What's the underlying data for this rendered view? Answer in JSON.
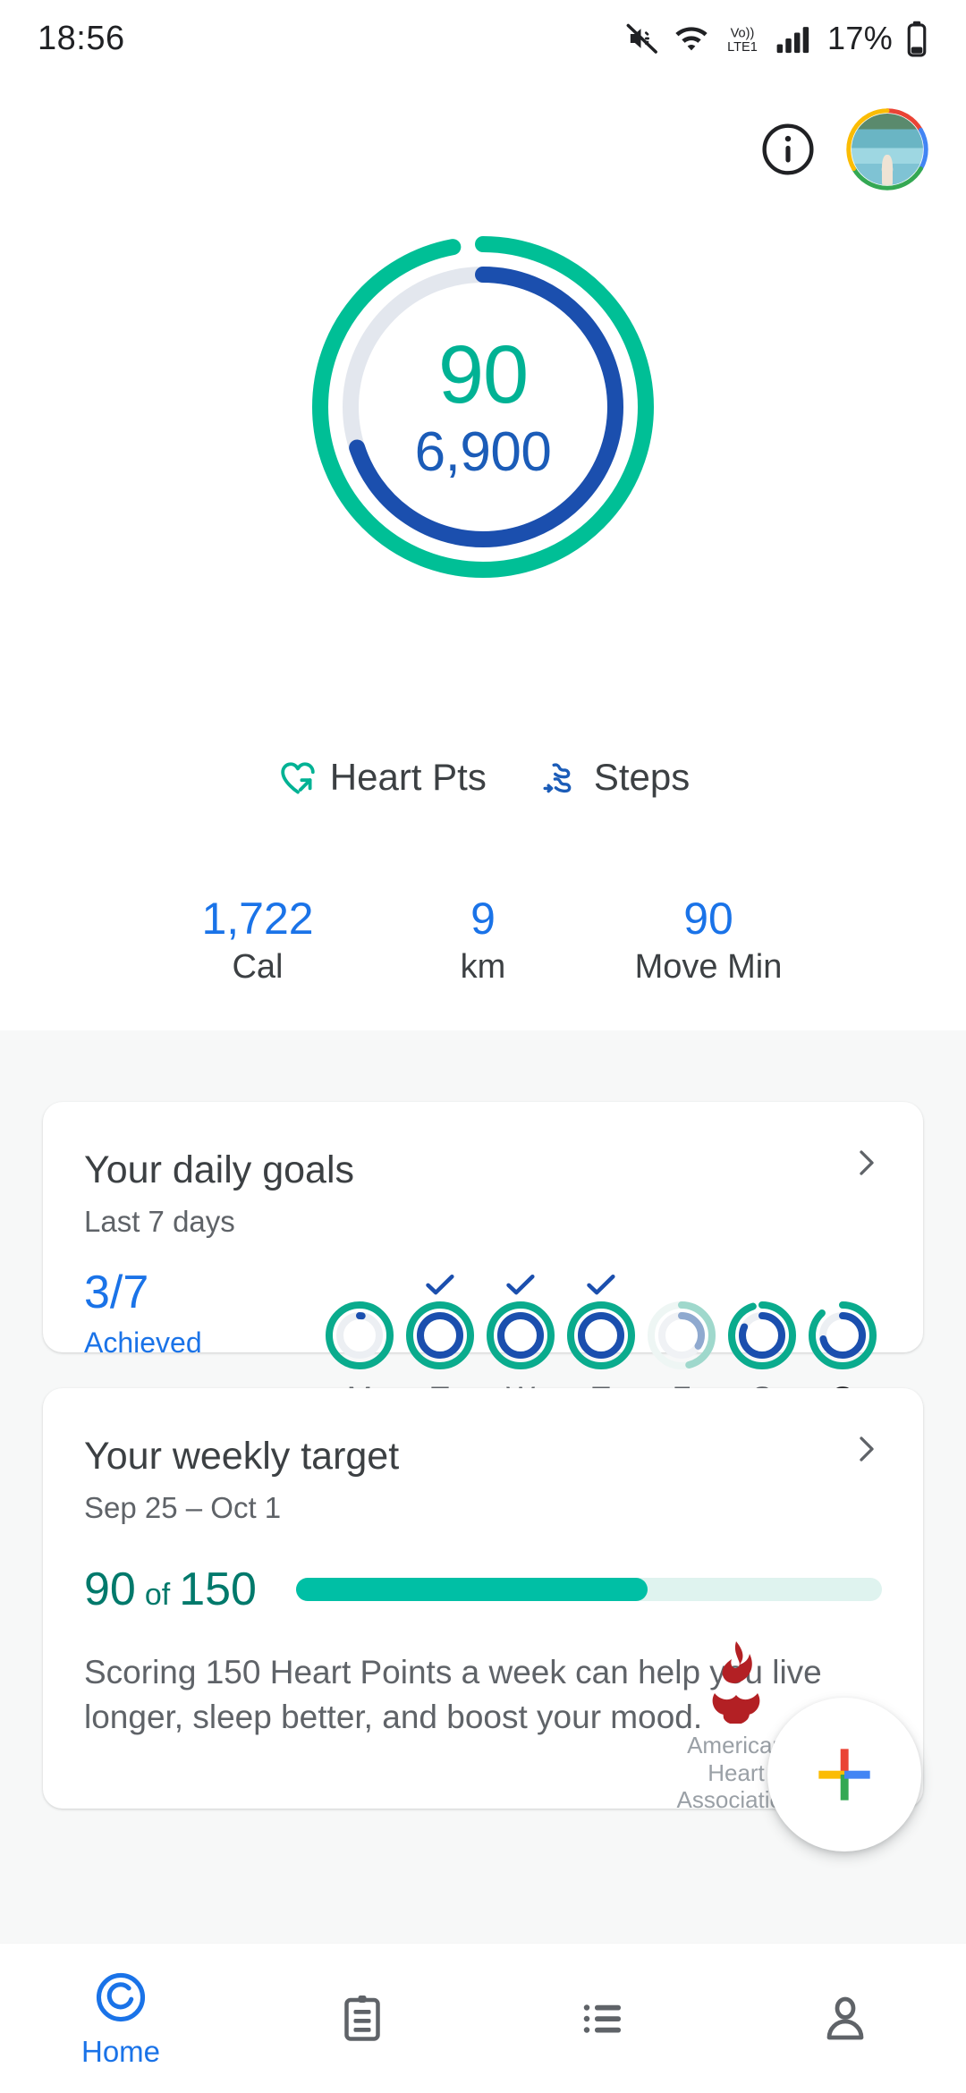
{
  "status_bar": {
    "time": "18:56",
    "battery_percent": "17%",
    "network_label": "LTE1",
    "volte_label": "Vo))",
    "icons": [
      "mute-icon",
      "wifi-icon",
      "volte-icon",
      "signal-icon",
      "battery-icon"
    ]
  },
  "top_actions": {
    "info_label": "i",
    "avatar_label": "profile-avatar"
  },
  "main_ring": {
    "heart_points": "90",
    "steps": "6,900",
    "heart_points_color": "#00b294",
    "steps_color": "#1b5cb8",
    "track_color": "#e3e7ee",
    "heart_points_pct": 97,
    "steps_pct": 70
  },
  "legend": [
    {
      "label": "Heart Pts",
      "icon": "heart-arrow-icon",
      "color": "#00b294"
    },
    {
      "label": "Steps",
      "icon": "shoe-icon",
      "color": "#1b5cb8"
    }
  ],
  "stats": [
    {
      "value": "1,722",
      "unit": "Cal"
    },
    {
      "value": "9",
      "unit": "km"
    },
    {
      "value": "90",
      "unit": "Move Min"
    }
  ],
  "daily_goals_card": {
    "title": "Your daily goals",
    "subtitle": "Last 7 days",
    "achieved_fraction": "3/7",
    "achieved_label": "Achieved",
    "chevron": "chevron-right-icon",
    "days": [
      {
        "label": "M",
        "heart_pct": 100,
        "steps_pct": 2,
        "achieved": false,
        "today": false,
        "dim": false
      },
      {
        "label": "T",
        "heart_pct": 100,
        "steps_pct": 100,
        "achieved": true,
        "today": false,
        "dim": false
      },
      {
        "label": "W",
        "heart_pct": 100,
        "steps_pct": 100,
        "achieved": true,
        "today": false,
        "dim": false
      },
      {
        "label": "T",
        "heart_pct": 100,
        "steps_pct": 100,
        "achieved": true,
        "today": false,
        "dim": false
      },
      {
        "label": "F",
        "heart_pct": 46,
        "steps_pct": 34,
        "achieved": false,
        "today": false,
        "dim": true
      },
      {
        "label": "S",
        "heart_pct": 95,
        "steps_pct": 82,
        "achieved": false,
        "today": false,
        "dim": false
      },
      {
        "label": "S",
        "heart_pct": 88,
        "steps_pct": 72,
        "achieved": false,
        "today": true,
        "dim": false
      }
    ]
  },
  "weekly_target_card": {
    "title": "Your weekly target",
    "subtitle": "Sep 25 – Oct 1",
    "chevron": "chevron-right-icon",
    "current": "90",
    "of_word": "of",
    "target": "150",
    "progress_pct": 60,
    "bar_color": "#00bfa5",
    "bar_track_color": "#dff3ef",
    "description": "Scoring 150 Heart Points a week can help you live longer, sleep better, and boost your mood.",
    "partner_name": "American\nHeart\nAssociation",
    "partner_logo": "aha-flame-icon"
  },
  "fab": {
    "label": "add-icon",
    "colors": [
      "#ea4335",
      "#fbbc04",
      "#34a853",
      "#4285f4"
    ]
  },
  "bottom_nav": [
    {
      "label": "Home",
      "icon": "home-ring-icon",
      "active": true
    },
    {
      "label": "",
      "icon": "journal-icon",
      "active": false
    },
    {
      "label": "",
      "icon": "list-icon",
      "active": false
    },
    {
      "label": "",
      "icon": "profile-icon",
      "active": false
    }
  ]
}
